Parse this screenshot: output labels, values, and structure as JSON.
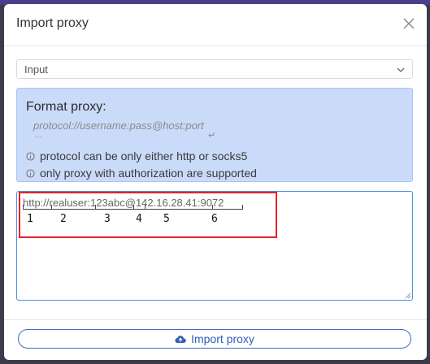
{
  "dialog": {
    "title": "Import proxy"
  },
  "select": {
    "value": "Input"
  },
  "info": {
    "title": "Format proxy:",
    "format": "protocol://username:pass@host:port",
    "dots": "...",
    "return_symbol": "↵",
    "notes": [
      "protocol can be only either http or socks5",
      "only proxy with authorization are supported"
    ]
  },
  "textarea": {
    "value": "http://realuser:123abc@142.16.28.41:9072",
    "segments": [
      "1",
      "2",
      "3",
      "4",
      "5",
      "6"
    ]
  },
  "footer": {
    "import_label": "Import proxy"
  },
  "colors": {
    "accent": "#2f5fb8",
    "info_bg": "#c9dbf9",
    "highlight": "#e8202a"
  },
  "icons": {
    "close": "close-icon",
    "dropdown": "chevron-down-icon",
    "note": "info-circle-icon",
    "import": "cloud-upload-icon"
  }
}
